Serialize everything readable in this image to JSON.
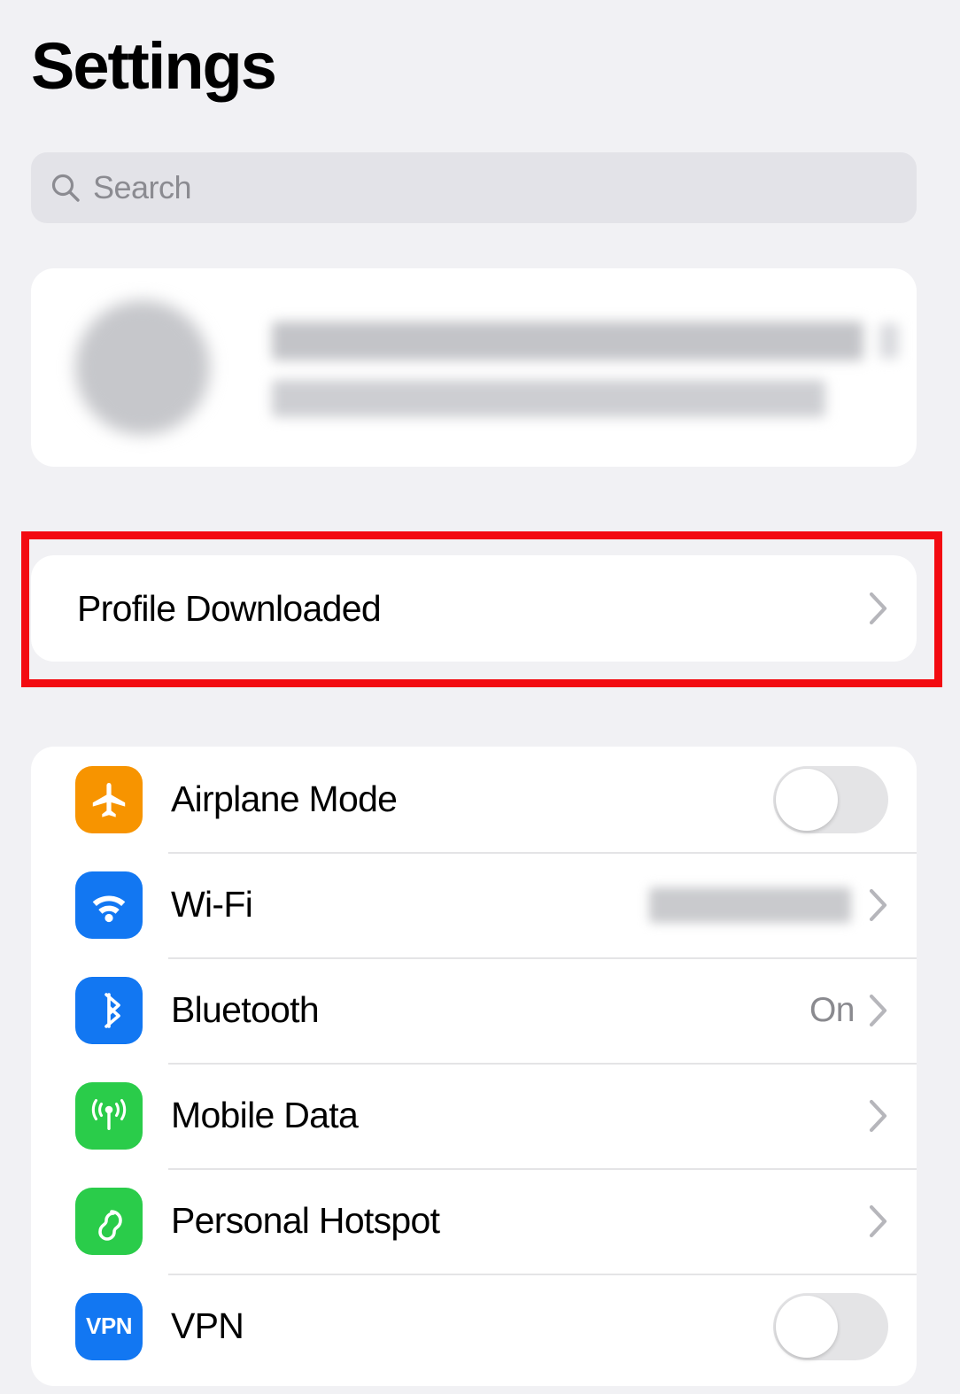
{
  "header": {
    "title": "Settings"
  },
  "search": {
    "placeholder": "Search",
    "value": "",
    "icon": "search-icon"
  },
  "profile": {
    "redacted": true,
    "avatar_icon": "avatar",
    "name_line": "",
    "subtitle_line": ""
  },
  "profile_downloaded": {
    "label": "Profile Downloaded",
    "chevron_icon": "chevron-right-icon",
    "highlighted": true,
    "highlight_color": "#f30b11"
  },
  "connectivity": {
    "rows": [
      {
        "label": "Airplane Mode",
        "icon": "airplane-icon",
        "icon_color": "#f79400",
        "control": "toggle",
        "toggle_state": "off",
        "value": ""
      },
      {
        "label": "Wi-Fi",
        "icon": "wifi-icon",
        "icon_color": "#1277f2",
        "control": "chevron",
        "value": "",
        "value_redacted": true
      },
      {
        "label": "Bluetooth",
        "icon": "bluetooth-icon",
        "icon_color": "#1277f2",
        "control": "chevron",
        "value": "On"
      },
      {
        "label": "Mobile Data",
        "icon": "cellular-icon",
        "icon_color": "#2acc4a",
        "control": "chevron",
        "value": ""
      },
      {
        "label": "Personal Hotspot",
        "icon": "hotspot-icon",
        "icon_color": "#2acc4a",
        "control": "chevron",
        "value": ""
      },
      {
        "label": "VPN",
        "icon": "vpn-icon",
        "icon_color": "#1277f2",
        "icon_text": "VPN",
        "control": "toggle",
        "toggle_state": "off",
        "value": ""
      }
    ]
  }
}
